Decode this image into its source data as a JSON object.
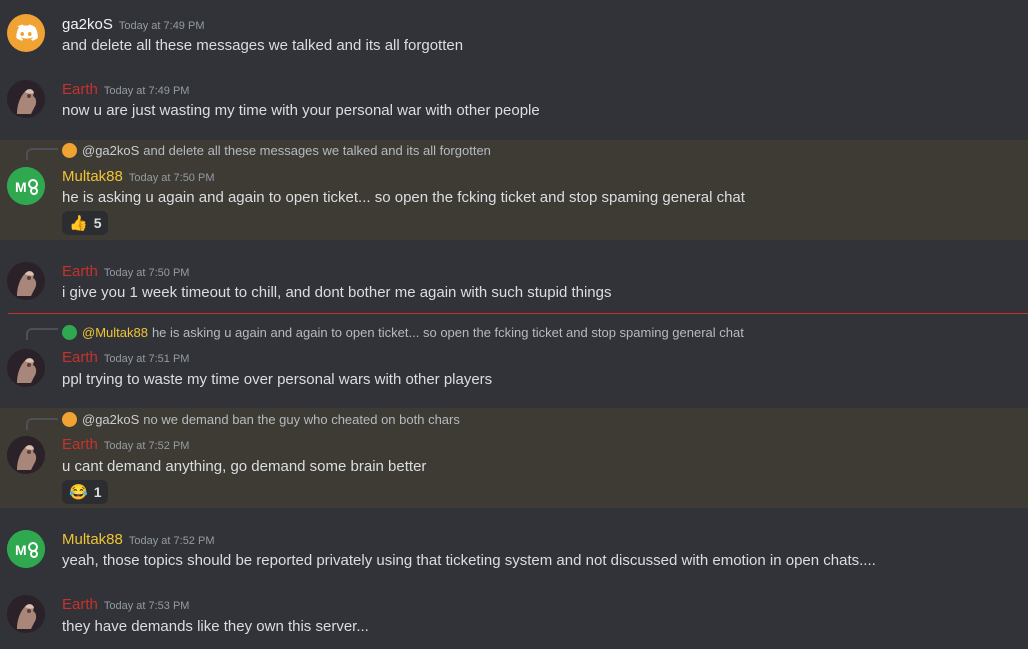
{
  "messages": [
    {
      "author": "ga2koS",
      "timestamp": "Today at 7:49 PM",
      "text": "and delete all these messages we talked and its all forgotten"
    },
    {
      "author": "Earth",
      "timestamp": "Today at 7:49 PM",
      "text": "now u are just wasting my time with your personal war with other people"
    },
    {
      "reply": {
        "name": "@ga2koS",
        "text": "and delete all these messages we talked and its all forgotten"
      },
      "author": "Multak88",
      "timestamp": "Today at 7:50 PM",
      "text": "he is asking u again and again to open ticket... so open the fcking ticket and stop spaming general chat",
      "reaction": {
        "emoji": "👍",
        "count": "5"
      }
    },
    {
      "author": "Earth",
      "timestamp": "Today at 7:50 PM",
      "text": "i give you 1 week timeout to chill, and dont bother me again with such stupid things"
    },
    {
      "reply": {
        "name": "@Multak88",
        "text": "he is asking u again and again to open ticket... so open the fcking ticket and stop spaming general chat"
      },
      "author": "Earth",
      "timestamp": "Today at 7:51 PM",
      "text": "ppl trying to waste my time over personal wars with other players"
    },
    {
      "reply": {
        "name": "@ga2koS",
        "text": "no we demand ban the guy who cheated on both chars"
      },
      "author": "Earth",
      "timestamp": "Today at 7:52 PM",
      "text": "u cant demand anything, go demand some brain better",
      "reaction": {
        "emoji": "😂",
        "count": "1"
      }
    },
    {
      "author": "Multak88",
      "timestamp": "Today at 7:52 PM",
      "text": "yeah, those topics should be reported privately using that ticketing system and not discussed with emotion in open chats...."
    },
    {
      "author": "Earth",
      "timestamp": "Today at 7:53 PM",
      "text": "they have demands like they own this server..."
    }
  ],
  "colors": {
    "earth": "#c8322d",
    "multak": "#f0c434",
    "discord": "#f0a233",
    "highlight": "#3e3b35"
  }
}
